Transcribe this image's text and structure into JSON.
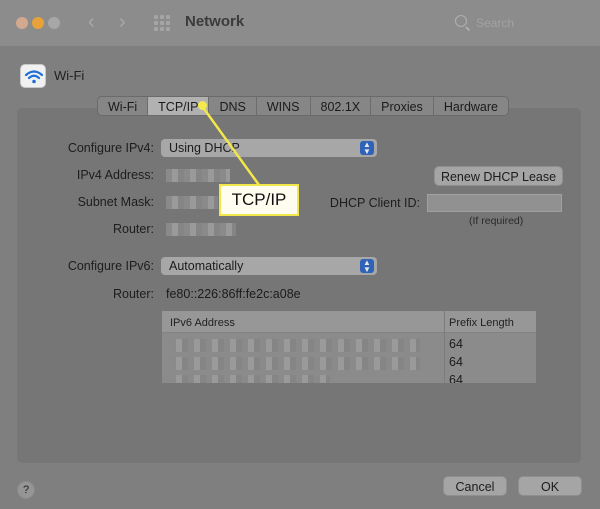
{
  "window": {
    "title": "Network",
    "search_placeholder": "Search",
    "back_icon": "chevron-left-icon",
    "forward_icon": "chevron-right-icon"
  },
  "interface": {
    "name": "Wi-Fi",
    "icon": "wifi-icon"
  },
  "tabs": [
    {
      "label": "Wi-Fi",
      "active": false
    },
    {
      "label": "TCP/IP",
      "active": true
    },
    {
      "label": "DNS",
      "active": false
    },
    {
      "label": "WINS",
      "active": false
    },
    {
      "label": "802.1X",
      "active": false
    },
    {
      "label": "Proxies",
      "active": false
    },
    {
      "label": "Hardware",
      "active": false
    }
  ],
  "ipv4": {
    "configure_label": "Configure IPv4:",
    "configure_value": "Using DHCP",
    "address_label": "IPv4 Address:",
    "subnet_label": "Subnet Mask:",
    "router_label": "Router:"
  },
  "dhcp": {
    "renew_button": "Renew DHCP Lease",
    "client_id_label": "DHCP Client ID:",
    "client_id_value": "",
    "client_id_note": "(If required)"
  },
  "ipv6": {
    "configure_label": "Configure IPv6:",
    "configure_value": "Automatically",
    "router_label": "Router:",
    "router_value": "fe80::226:86ff:fe2c:a08e",
    "table": {
      "columns": [
        "IPv6 Address",
        "Prefix Length"
      ],
      "rows": [
        {
          "prefix_length": "64"
        },
        {
          "prefix_length": "64"
        },
        {
          "prefix_length": "64"
        }
      ]
    }
  },
  "footer": {
    "help_label": "?",
    "cancel_button": "Cancel",
    "ok_button": "OK"
  },
  "annotation": {
    "callout_text": "TCP/IP",
    "color": "#f2e64a"
  },
  "colors": {
    "accent": "#2f63b8",
    "traffic_min": "#e7a23a"
  }
}
